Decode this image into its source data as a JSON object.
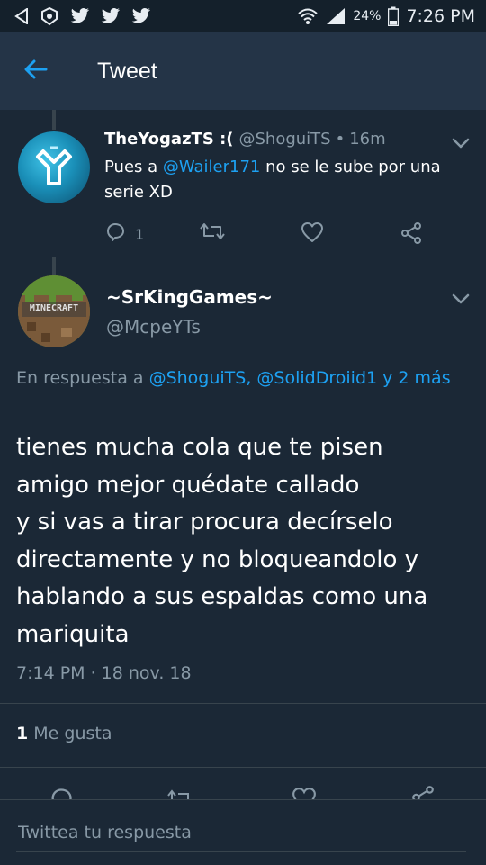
{
  "status_bar": {
    "battery_percent": "24%",
    "clock": "7:26 PM",
    "left_icons": [
      "back-arrow-icon",
      "amino-icon",
      "twitter-icon",
      "twitter-icon",
      "twitter-icon"
    ],
    "right_icons": [
      "wifi-icon",
      "signal-icon",
      "battery-icon"
    ]
  },
  "appbar": {
    "title": "Tweet",
    "back_icon": "arrow-left-icon"
  },
  "colors": {
    "accent": "#1da1f2",
    "background": "#1b2836",
    "muted": "#8899a6",
    "header": "#243447"
  },
  "parent_tweet": {
    "display_name": "TheYogazTS :(",
    "handle": "@ShoguiTS",
    "time": "16m",
    "text_before": "Pues a ",
    "mention": "@Wailer171",
    "text_after": " no se le sube por una serie XD",
    "reply_count": "1"
  },
  "main_tweet": {
    "display_name": "~SrKingGames~",
    "handle": "@McpeYTs",
    "avatar_text": "MINECRAFT",
    "reply_prefix": "En respuesta a ",
    "reply_mentions": "@ShoguiTS, @SolidDroiid1 y 2 más",
    "lines": [
      "tienes mucha cola que te pisen",
      "amigo mejor quédate callado",
      "y si vas a tirar procura decírselo",
      "directamente y no bloqueandolo y",
      "hablando a sus espaldas como una",
      "mariquita"
    ],
    "timestamp": "7:14 PM · 18 nov. 18",
    "like_count": "1",
    "like_label": "Me gusta"
  },
  "reply_box": {
    "placeholder": "Twittea tu respuesta"
  }
}
